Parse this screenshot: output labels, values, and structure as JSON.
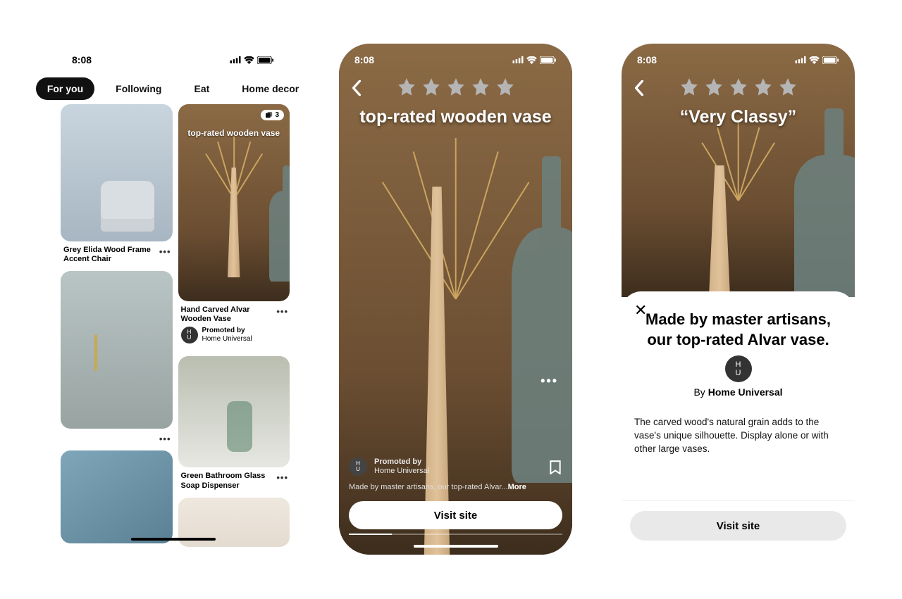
{
  "time": "8:08",
  "tabs": [
    "For you",
    "Following",
    "Eat",
    "Home decor"
  ],
  "active_tab_index": 0,
  "phone1": {
    "left_col": {
      "pin1_title": "Grey Elida Wood Frame Accent Chair",
      "pin3_partial": ""
    },
    "right_col": {
      "pin1_badge_count": "3",
      "pin1_overlay": "top-rated wooden vase",
      "pin1_title": "Hand Carved Alvar Wooden Vase",
      "pin1_promo_label": "Promoted by",
      "pin1_promo_by": "Home Universal",
      "pin2_title": "Green Bathroom Glass Soap Dispenser"
    }
  },
  "phone2": {
    "title": "top-rated wooden vase",
    "promo_label": "Promoted by",
    "promo_by": "Home Universal",
    "desc_prefix": "Made by master artisans, our top-rated Alvar...",
    "desc_more": "More",
    "visit_label": "Visit site"
  },
  "phone3": {
    "title": "“Very Classy”",
    "sheet_title": "Made by master artisans, our top-rated Alvar vase.",
    "by_prefix": "By ",
    "brand": "Home Universal",
    "sheet_desc": "The carved wood's natural grain adds to the vase's unique silhouette. Display alone or with other large vases.",
    "visit_label": "Visit site"
  },
  "icons": {
    "avatar_initials": "H\nU"
  }
}
